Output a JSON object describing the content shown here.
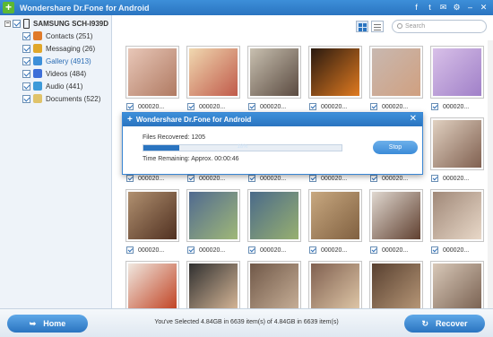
{
  "app": {
    "title": "Wondershare Dr.Fone for Android"
  },
  "titlebar_icons": [
    "facebook-icon",
    "twitter-icon",
    "feedback-icon",
    "settings-icon",
    "minimize-icon",
    "close-icon"
  ],
  "tree": {
    "device": "SAMSUNG SCH-I939D",
    "categories": [
      {
        "label": "Contacts (251)",
        "icon": "contacts-icon",
        "color": "#e07b2a"
      },
      {
        "label": "Messaging (26)",
        "icon": "messaging-icon",
        "color": "#e0a72a"
      },
      {
        "label": "Gallery (4913)",
        "icon": "gallery-icon",
        "color": "#3d8fd9"
      },
      {
        "label": "Videos (484)",
        "icon": "videos-icon",
        "color": "#3d6fd9"
      },
      {
        "label": "Audio (441)",
        "icon": "audio-icon",
        "color": "#3d9ad9"
      },
      {
        "label": "Documents (522)",
        "icon": "documents-icon",
        "color": "#e0c36a"
      }
    ]
  },
  "search": {
    "placeholder": "Search"
  },
  "file_label": "000020...",
  "dialog": {
    "title": "Wondershare Dr.Fone for Android",
    "files_recovered": "Files Recovered: 1205",
    "progress_label": "18%",
    "progress": 0.18,
    "time_remaining": "Time Remaining: Approx. 00:00:46",
    "stop_label": "Stop"
  },
  "footer": {
    "home_label": "Home",
    "recover_label": "Recover",
    "status": "You've Selected 4.84GB in 6639 item(s) of 4.84GB in 6639 item(s)"
  }
}
